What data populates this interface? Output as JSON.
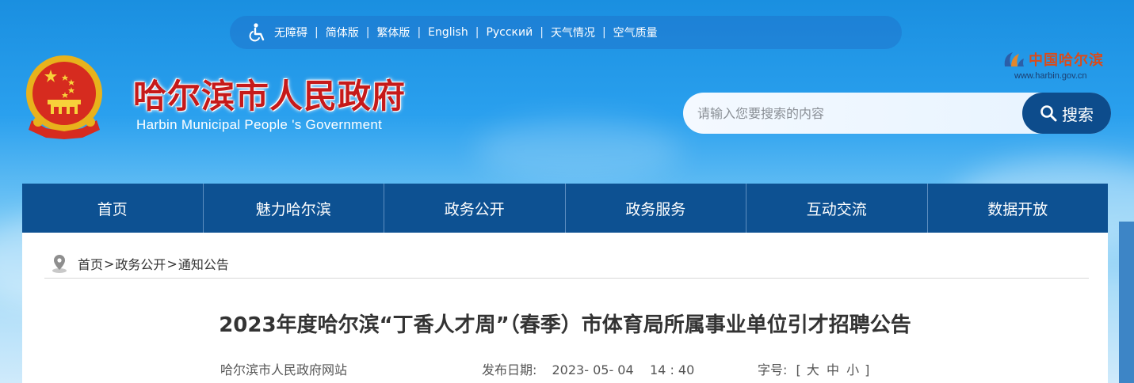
{
  "topbar": {
    "links": [
      "无障碍",
      "简体版",
      "繁体版",
      "English",
      "Русский",
      "天气情况",
      "空气质量"
    ],
    "separator": "|"
  },
  "header": {
    "title": "哈尔滨市人民政府",
    "subtitle": "Harbin Municipal People 's Government",
    "right_logo_text": "中国哈尔滨",
    "right_logo_url": "www.harbin.gov.cn"
  },
  "search": {
    "placeholder": "请输入您要搜索的内容",
    "button_label": "搜索"
  },
  "nav": {
    "items": [
      "首页",
      "魅力哈尔滨",
      "政务公开",
      "政务服务",
      "互动交流",
      "数据开放"
    ]
  },
  "breadcrumb": {
    "items": [
      "首页",
      "政务公开",
      "通知公告"
    ],
    "separator": ">"
  },
  "article": {
    "title": "2023年度哈尔滨“丁香人才周”（春季）市体育局所属事业单位引才招聘公告",
    "source": "哈尔滨市人民政府网站",
    "date_label": "发布日期:",
    "date_value": "2023- 05- 04    14 : 40",
    "font_label": "字号:",
    "font_open": "[",
    "font_large": "大",
    "font_medium": "中",
    "font_small": "小",
    "font_close": "]"
  },
  "colors": {
    "nav_bg": "#0d5192",
    "search_button": "#0d4c8c",
    "title_red": "#c61a1a"
  },
  "icons": [
    "accessibility-icon",
    "national-emblem",
    "search-icon",
    "location-pin-icon",
    "harbin-logo"
  ]
}
